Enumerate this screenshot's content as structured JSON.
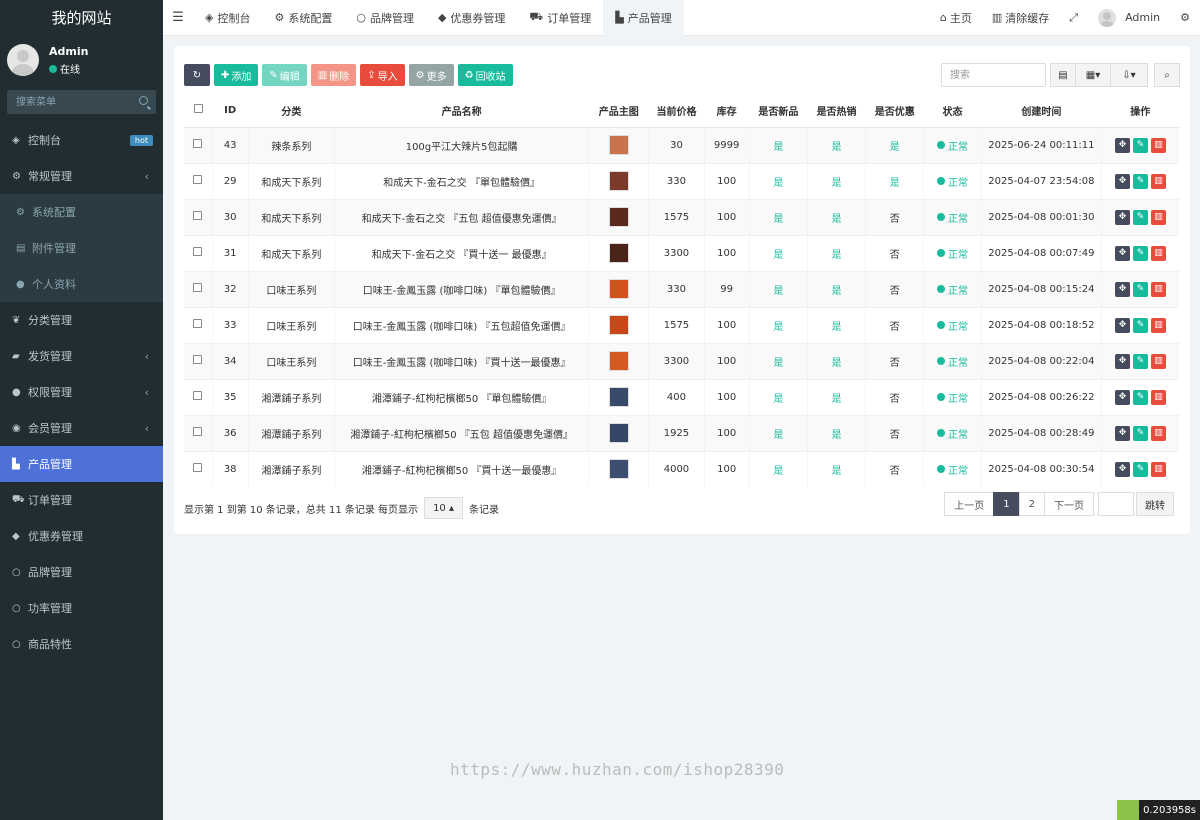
{
  "sidebar": {
    "logo": "我的网站",
    "user": {
      "name": "Admin",
      "status": "在线"
    },
    "search_placeholder": "搜索菜单",
    "items": [
      {
        "label": "控制台",
        "icon": "dashboard-icon",
        "glyph": "◈",
        "badge": "hot"
      },
      {
        "label": "常规管理",
        "icon": "cogs-icon",
        "glyph": "⚙",
        "caret": "‹"
      },
      {
        "label": "系统配置",
        "icon": "gear-icon",
        "glyph": "⚙",
        "sub": true
      },
      {
        "label": "附件管理",
        "icon": "file-icon",
        "glyph": "▤",
        "sub": true
      },
      {
        "label": "个人资料",
        "icon": "user-icon",
        "glyph": "●",
        "sub": true
      },
      {
        "label": "分类管理",
        "icon": "leaf-icon",
        "glyph": "❦"
      },
      {
        "label": "发货管理",
        "icon": "truck-icon",
        "glyph": "▰",
        "caret": "‹"
      },
      {
        "label": "权限管理",
        "icon": "group-icon",
        "glyph": "●",
        "caret": "‹"
      },
      {
        "label": "会员管理",
        "icon": "user-circle-icon",
        "glyph": "◉",
        "caret": "‹"
      },
      {
        "label": "产品管理",
        "icon": "shopping-bag-icon",
        "glyph": "▙",
        "active": true
      },
      {
        "label": "订单管理",
        "icon": "cart-icon",
        "glyph": "⛟"
      },
      {
        "label": "优惠券管理",
        "icon": "tag-icon",
        "glyph": "◆"
      },
      {
        "label": "品牌管理",
        "icon": "circle-icon",
        "glyph": "○"
      },
      {
        "label": "功率管理",
        "icon": "circle-icon",
        "glyph": "○"
      },
      {
        "label": "商品特性",
        "icon": "circle-icon",
        "glyph": "○"
      }
    ]
  },
  "topnav": {
    "tabs": [
      {
        "label": "控制台",
        "icon": "dashboard-icon",
        "glyph": "◈"
      },
      {
        "label": "系统配置",
        "icon": "gear-icon",
        "glyph": "⚙"
      },
      {
        "label": "品牌管理",
        "icon": "circle-icon",
        "glyph": "○"
      },
      {
        "label": "优惠券管理",
        "icon": "tag-icon",
        "glyph": "◆"
      },
      {
        "label": "订单管理",
        "icon": "cart-icon",
        "glyph": "⛟"
      },
      {
        "label": "产品管理",
        "icon": "shopping-bag-icon",
        "glyph": "▙",
        "active": true
      }
    ],
    "home": "主页",
    "clear_cache": "清除缓存",
    "admin": "Admin"
  },
  "toolbar": {
    "add": "添加",
    "edit": "编辑",
    "delete": "删除",
    "import": "导入",
    "more": "更多",
    "recycle": "回收站",
    "search_placeholder": "搜索"
  },
  "table": {
    "headers": [
      "",
      "ID",
      "分类",
      "产品名称",
      "产品主图",
      "当前价格",
      "库存",
      "是否新品",
      "是否热销",
      "是否优惠",
      "状态",
      "创建时间",
      "操作"
    ],
    "rows": [
      {
        "id": "43",
        "category": "辣条系列",
        "name": "100g平江大辣片5包起購",
        "price": "30",
        "stock": "9999",
        "is_new": "是",
        "is_hot": "是",
        "is_sale": "是",
        "status": "正常",
        "created": "2025-06-24 00:11:11",
        "thumb": "#c8734a"
      },
      {
        "id": "29",
        "category": "和成天下系列",
        "name": "和成天下-金石之交 『單包體驗價』",
        "price": "330",
        "stock": "100",
        "is_new": "是",
        "is_hot": "是",
        "is_sale": "是",
        "status": "正常",
        "created": "2025-04-07 23:54:08",
        "thumb": "#7a3b2a"
      },
      {
        "id": "30",
        "category": "和成天下系列",
        "name": "和成天下-金石之交 『五包 超值優惠免運價』",
        "price": "1575",
        "stock": "100",
        "is_new": "是",
        "is_hot": "是",
        "is_sale": "否",
        "status": "正常",
        "created": "2025-04-08 00:01:30",
        "thumb": "#5a2a1e"
      },
      {
        "id": "31",
        "category": "和成天下系列",
        "name": "和成天下-金石之交 『買十送一 最優惠』",
        "price": "3300",
        "stock": "100",
        "is_new": "是",
        "is_hot": "是",
        "is_sale": "否",
        "status": "正常",
        "created": "2025-04-08 00:07:49",
        "thumb": "#4a2418"
      },
      {
        "id": "32",
        "category": "口味王系列",
        "name": "口味王-金鳳玉露 (咖啡口味) 『單包體驗價』",
        "price": "330",
        "stock": "99",
        "is_new": "是",
        "is_hot": "是",
        "is_sale": "否",
        "status": "正常",
        "created": "2025-04-08 00:15:24",
        "thumb": "#d2521e"
      },
      {
        "id": "33",
        "category": "口味王系列",
        "name": "口味王-金鳳玉露 (咖啡口味) 『五包超值免運價』",
        "price": "1575",
        "stock": "100",
        "is_new": "是",
        "is_hot": "是",
        "is_sale": "否",
        "status": "正常",
        "created": "2025-04-08 00:18:52",
        "thumb": "#c9481a"
      },
      {
        "id": "34",
        "category": "口味王系列",
        "name": "口味王-金鳳玉露 (咖啡口味) 『買十送一最優惠』",
        "price": "3300",
        "stock": "100",
        "is_new": "是",
        "is_hot": "是",
        "is_sale": "否",
        "status": "正常",
        "created": "2025-04-08 00:22:04",
        "thumb": "#d35a22"
      },
      {
        "id": "35",
        "category": "湘潭鋪子系列",
        "name": "湘潭鋪子-紅枸杞檳榔50 『單包體驗價』",
        "price": "400",
        "stock": "100",
        "is_new": "是",
        "is_hot": "是",
        "is_sale": "否",
        "status": "正常",
        "created": "2025-04-08 00:26:22",
        "thumb": "#3a4a6a"
      },
      {
        "id": "36",
        "category": "湘潭鋪子系列",
        "name": "湘潭鋪子-紅枸杞檳榔50 『五包 超值優惠免運價』",
        "price": "1925",
        "stock": "100",
        "is_new": "是",
        "is_hot": "是",
        "is_sale": "否",
        "status": "正常",
        "created": "2025-04-08 00:28:49",
        "thumb": "#344566"
      },
      {
        "id": "38",
        "category": "湘潭鋪子系列",
        "name": "湘潭鋪子-紅枸杞檳榔50 『買十送一最優惠』",
        "price": "4000",
        "stock": "100",
        "is_new": "是",
        "is_hot": "是",
        "is_sale": "否",
        "status": "正常",
        "created": "2025-04-08 00:30:54",
        "thumb": "#3d4e70"
      }
    ]
  },
  "pagination": {
    "info_prefix": "显示第 1 到第 10 条记录，总共 11 条记录 每页显示",
    "page_size": "10",
    "info_suffix": "条记录",
    "prev": "上一页",
    "pages": [
      "1",
      "2"
    ],
    "next": "下一页",
    "jump": "跳转"
  },
  "watermark": "https://www.huzhan.com/ishop28390",
  "timer": "0.203958s"
}
